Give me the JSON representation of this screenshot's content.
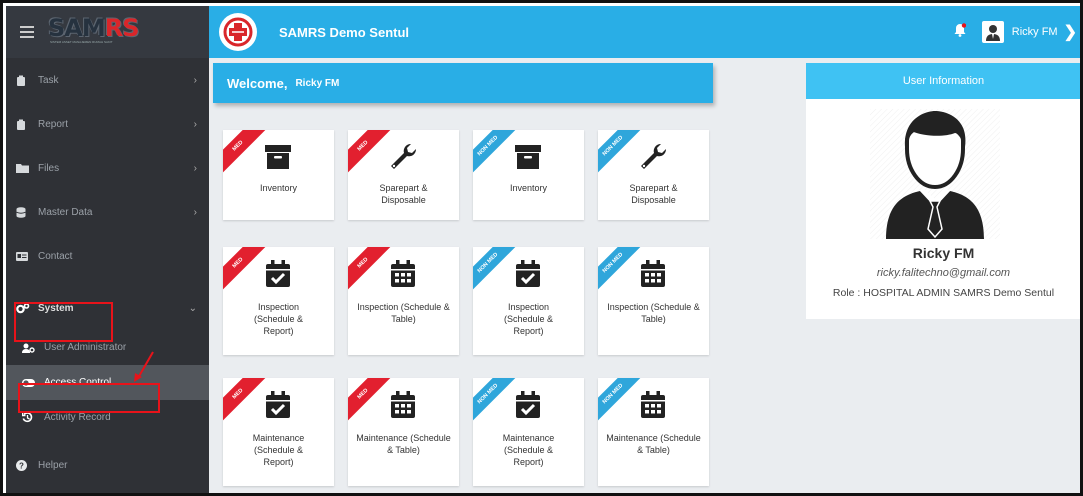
{
  "logo": {
    "text_main": "SAM",
    "text_accent": "RS",
    "subtitle": "SISTEM ASSET MANAJEMEN RUMAH SAKIT"
  },
  "header": {
    "brand": "SAMRS Demo Sentul",
    "user": "Ricky FM"
  },
  "sidebar": {
    "items": [
      {
        "label": "Task",
        "icon": "clipboard-icon"
      },
      {
        "label": "Report",
        "icon": "clipboard-icon"
      },
      {
        "label": "Files",
        "icon": "folder-icon"
      },
      {
        "label": "Master Data",
        "icon": "database-icon"
      },
      {
        "label": "Contact",
        "icon": "id-card-icon"
      },
      {
        "label": "System",
        "icon": "cogs-icon"
      }
    ],
    "subitems": [
      {
        "label": "User Administrator",
        "icon": "users-cog-icon"
      },
      {
        "label": "Access Control",
        "icon": "toggle-icon"
      },
      {
        "label": "Activity Record",
        "icon": "history-icon"
      }
    ],
    "helper": "Helper"
  },
  "welcome": {
    "greeting": "Welcome,",
    "name": "Ricky FM"
  },
  "tiles": [
    {
      "ribbon": "MED",
      "label": "Inventory",
      "icon": "archive-icon"
    },
    {
      "ribbon": "MED",
      "label": "Sparepart & Disposable",
      "icon": "wrench-icon"
    },
    {
      "ribbon": "NON MED",
      "label": "Inventory",
      "icon": "archive-icon"
    },
    {
      "ribbon": "NON MED",
      "label": "Sparepart & Disposable",
      "icon": "wrench-icon"
    },
    {
      "ribbon": "MED",
      "label": "Inspection (Schedule & Report)",
      "icon": "calendar-check-icon"
    },
    {
      "ribbon": "MED",
      "label": "Inspection (Schedule & Table)",
      "icon": "calendar-table-icon"
    },
    {
      "ribbon": "NON MED",
      "label": "Inspection (Schedule & Report)",
      "icon": "calendar-check-icon"
    },
    {
      "ribbon": "NON MED",
      "label": "Inspection (Schedule & Table)",
      "icon": "calendar-table-icon"
    },
    {
      "ribbon": "MED",
      "label": "Maintenance (Schedule & Report)",
      "icon": "calendar-check-icon"
    },
    {
      "ribbon": "MED",
      "label": "Maintenance (Schedule & Table)",
      "icon": "calendar-table-icon"
    },
    {
      "ribbon": "NON MED",
      "label": "Maintenance (Schedule & Report)",
      "icon": "calendar-check-icon"
    },
    {
      "ribbon": "NON MED",
      "label": "Maintenance (Schedule & Table)",
      "icon": "calendar-table-icon"
    }
  ],
  "user_info": {
    "title": "User Information",
    "name": "Ricky FM",
    "email": "ricky.falitechno@gmail.com",
    "role": "Role : HOSPITAL ADMIN SAMRS Demo Sentul"
  },
  "colors": {
    "header": "#29aee6",
    "sidebar": "#2f3136",
    "med_ribbon": "#e2202f",
    "non_med_ribbon": "#2fa6db",
    "highlight": "#e8131a"
  }
}
